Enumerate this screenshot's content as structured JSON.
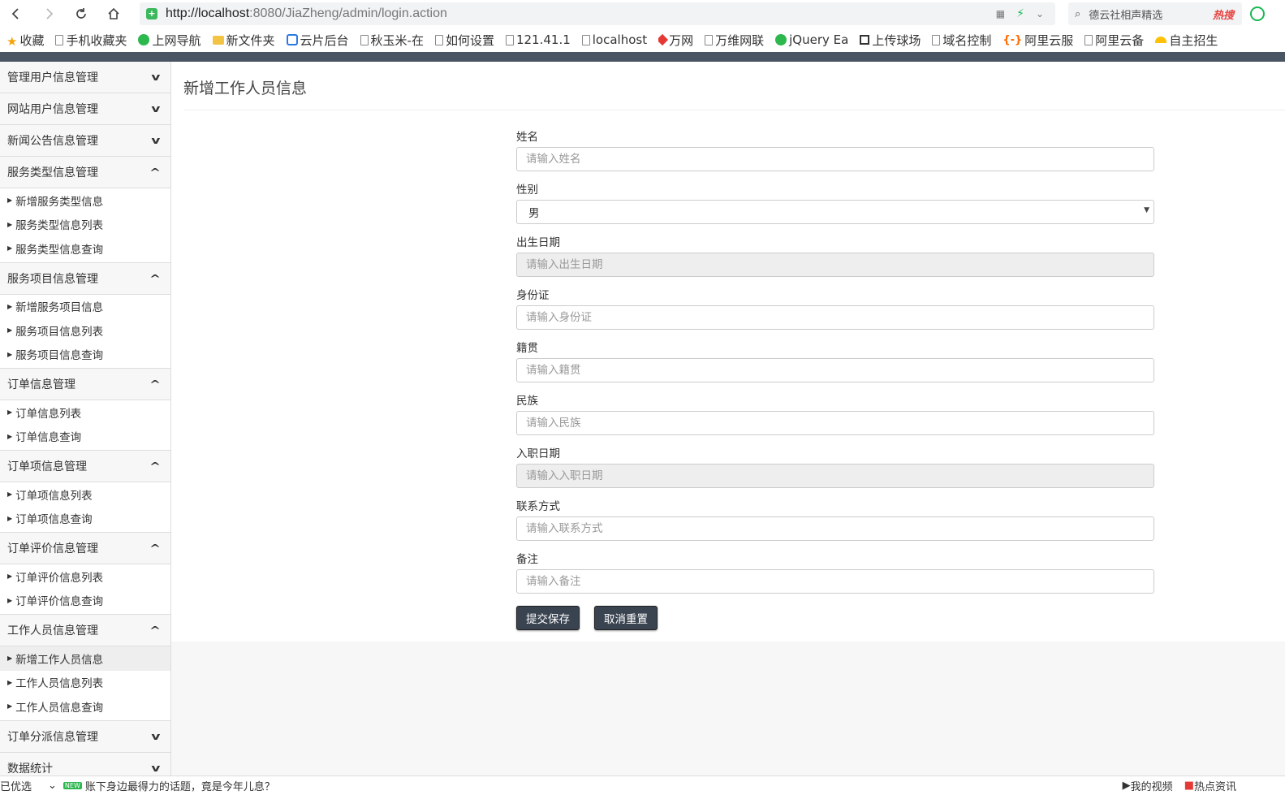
{
  "browser": {
    "url_host": "http://localhost",
    "url_rest": ":8080/JiaZheng/admin/login.action",
    "search_text": "德云社相声精选",
    "search_hot": "热搜"
  },
  "bookmarks": [
    {
      "icon": "star",
      "label": "收藏"
    },
    {
      "icon": "page",
      "label": "手机收藏夹"
    },
    {
      "icon": "green",
      "label": "上网导航"
    },
    {
      "icon": "folder",
      "label": "新文件夹"
    },
    {
      "icon": "blue",
      "label": "云片后台"
    },
    {
      "icon": "page",
      "label": "秋玉米-在"
    },
    {
      "icon": "page",
      "label": "如何设置"
    },
    {
      "icon": "page",
      "label": "121.41.1"
    },
    {
      "icon": "page",
      "label": "localhost"
    },
    {
      "icon": "red",
      "label": "万网"
    },
    {
      "icon": "page",
      "label": "万维网联"
    },
    {
      "icon": "green",
      "label": "jQuery Ea"
    },
    {
      "icon": "dark",
      "label": "上传球场"
    },
    {
      "icon": "page",
      "label": "域名控制"
    },
    {
      "icon": "orange",
      "label": "阿里云服"
    },
    {
      "icon": "page",
      "label": "阿里云备"
    },
    {
      "icon": "yellow",
      "label": "自主招生"
    }
  ],
  "sidebar": {
    "groups": [
      {
        "label": "管理用户信息管理",
        "expanded": false,
        "items": []
      },
      {
        "label": "网站用户信息管理",
        "expanded": false,
        "items": []
      },
      {
        "label": "新闻公告信息管理",
        "expanded": false,
        "items": []
      },
      {
        "label": "服务类型信息管理",
        "expanded": true,
        "items": [
          "新增服务类型信息",
          "服务类型信息列表",
          "服务类型信息查询"
        ]
      },
      {
        "label": "服务项目信息管理",
        "expanded": true,
        "items": [
          "新增服务项目信息",
          "服务项目信息列表",
          "服务项目信息查询"
        ]
      },
      {
        "label": "订单信息管理",
        "expanded": true,
        "items": [
          "订单信息列表",
          "订单信息查询"
        ]
      },
      {
        "label": "订单项信息管理",
        "expanded": true,
        "items": [
          "订单项信息列表",
          "订单项信息查询"
        ]
      },
      {
        "label": "订单评价信息管理",
        "expanded": true,
        "items": [
          "订单评价信息列表",
          "订单评价信息查询"
        ]
      },
      {
        "label": "工作人员信息管理",
        "expanded": true,
        "items": [
          "新增工作人员信息",
          "工作人员信息列表",
          "工作人员信息查询"
        ]
      },
      {
        "label": "订单分派信息管理",
        "expanded": false,
        "items": []
      },
      {
        "label": "数据统计",
        "expanded": false,
        "items": []
      }
    ],
    "active_item": "新增工作人员信息"
  },
  "main": {
    "title": "新增工作人员信息",
    "fields": [
      {
        "key": "name",
        "label": "姓名",
        "type": "text",
        "placeholder": "请输入姓名"
      },
      {
        "key": "gender",
        "label": "性别",
        "type": "select",
        "value": "男"
      },
      {
        "key": "birthdate",
        "label": "出生日期",
        "type": "readonly",
        "placeholder": "请输入出生日期"
      },
      {
        "key": "idcard",
        "label": "身份证",
        "type": "text",
        "placeholder": "请输入身份证"
      },
      {
        "key": "native",
        "label": "籍贯",
        "type": "text",
        "placeholder": "请输入籍贯"
      },
      {
        "key": "ethnicity",
        "label": "民族",
        "type": "text",
        "placeholder": "请输入民族"
      },
      {
        "key": "hiredate",
        "label": "入职日期",
        "type": "readonly",
        "placeholder": "请输入入职日期"
      },
      {
        "key": "contact",
        "label": "联系方式",
        "type": "text",
        "placeholder": "请输入联系方式"
      },
      {
        "key": "remark",
        "label": "备注",
        "type": "text",
        "placeholder": "请输入备注"
      }
    ],
    "submit_label": "提交保存",
    "reset_label": "取消重置"
  },
  "statusbar": {
    "left_text": "已优选",
    "news_text": "账下身边最得力的话题，竟是今年儿息？",
    "right_video": "我的视频",
    "right_hot": "热点资讯"
  },
  "colors": {
    "top_band": "#4a5563",
    "button_bg": "#3a4451",
    "sidebar_bg": "#f7f7f7"
  }
}
